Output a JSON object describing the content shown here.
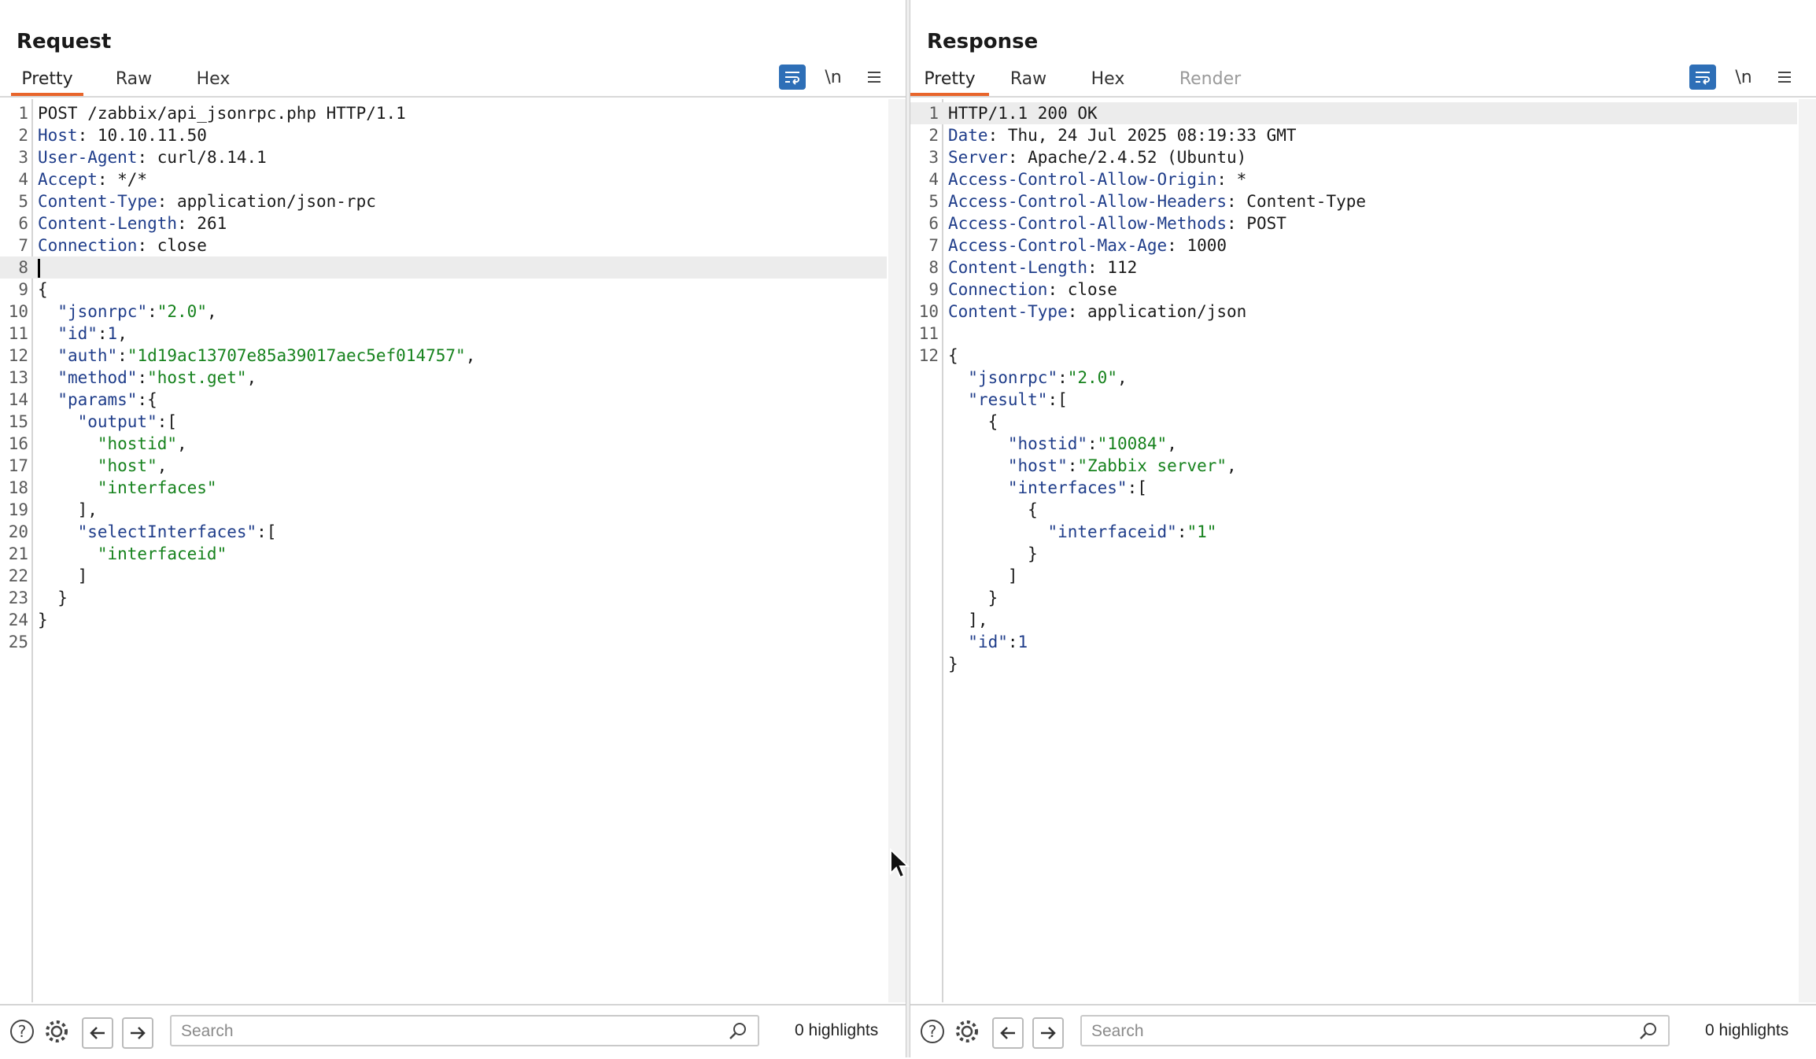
{
  "layout_toggle": {
    "options": [
      "side-by-side",
      "stacked",
      "single"
    ],
    "active": "side-by-side"
  },
  "request": {
    "title": "Request",
    "tabs": [
      {
        "label": "Pretty",
        "active": true
      },
      {
        "label": "Raw"
      },
      {
        "label": "Hex"
      }
    ],
    "toolbar": {
      "wrap_icon": "wrap-icon",
      "newline_label": "\\n",
      "menu_icon": "menu-icon"
    },
    "lines": [
      [
        {
          "t": "POST /zabbix/api_jsonrpc.php HTTP/1.1",
          "c": ""
        }
      ],
      [
        {
          "t": "Host",
          "c": "k"
        },
        {
          "t": ": 10.10.11.50",
          "c": ""
        }
      ],
      [
        {
          "t": "User-Agent",
          "c": "k"
        },
        {
          "t": ": curl/8.14.1",
          "c": ""
        }
      ],
      [
        {
          "t": "Accept",
          "c": "k"
        },
        {
          "t": ": */*",
          "c": ""
        }
      ],
      [
        {
          "t": "Content-Type",
          "c": "k"
        },
        {
          "t": ": application/json-rpc",
          "c": ""
        }
      ],
      [
        {
          "t": "Content-Length",
          "c": "k"
        },
        {
          "t": ": 261",
          "c": ""
        }
      ],
      [
        {
          "t": "Connection",
          "c": "k"
        },
        {
          "t": ": close",
          "c": ""
        }
      ],
      [],
      [
        {
          "t": "{",
          "c": ""
        }
      ],
      [
        {
          "t": "  ",
          "c": ""
        },
        {
          "t": "\"jsonrpc\"",
          "c": "k"
        },
        {
          "t": ":",
          "c": ""
        },
        {
          "t": "\"2.0\"",
          "c": "s"
        },
        {
          "t": ",",
          "c": ""
        }
      ],
      [
        {
          "t": "  ",
          "c": ""
        },
        {
          "t": "\"id\"",
          "c": "k"
        },
        {
          "t": ":",
          "c": ""
        },
        {
          "t": "1",
          "c": "n"
        },
        {
          "t": ",",
          "c": ""
        }
      ],
      [
        {
          "t": "  ",
          "c": ""
        },
        {
          "t": "\"auth\"",
          "c": "k"
        },
        {
          "t": ":",
          "c": ""
        },
        {
          "t": "\"1d19ac13707e85a39017aec5ef014757\"",
          "c": "s"
        },
        {
          "t": ",",
          "c": ""
        }
      ],
      [
        {
          "t": "  ",
          "c": ""
        },
        {
          "t": "\"method\"",
          "c": "k"
        },
        {
          "t": ":",
          "c": ""
        },
        {
          "t": "\"host.get\"",
          "c": "s"
        },
        {
          "t": ",",
          "c": ""
        }
      ],
      [
        {
          "t": "  ",
          "c": ""
        },
        {
          "t": "\"params\"",
          "c": "k"
        },
        {
          "t": ":{",
          "c": ""
        }
      ],
      [
        {
          "t": "    ",
          "c": ""
        },
        {
          "t": "\"output\"",
          "c": "k"
        },
        {
          "t": ":[",
          "c": ""
        }
      ],
      [
        {
          "t": "      ",
          "c": ""
        },
        {
          "t": "\"hostid\"",
          "c": "s"
        },
        {
          "t": ",",
          "c": ""
        }
      ],
      [
        {
          "t": "      ",
          "c": ""
        },
        {
          "t": "\"host\"",
          "c": "s"
        },
        {
          "t": ",",
          "c": ""
        }
      ],
      [
        {
          "t": "      ",
          "c": ""
        },
        {
          "t": "\"interfaces\"",
          "c": "s"
        }
      ],
      [
        {
          "t": "    ],",
          "c": ""
        }
      ],
      [
        {
          "t": "    ",
          "c": ""
        },
        {
          "t": "\"selectInterfaces\"",
          "c": "k"
        },
        {
          "t": ":[",
          "c": ""
        }
      ],
      [
        {
          "t": "      ",
          "c": ""
        },
        {
          "t": "\"interfaceid\"",
          "c": "s"
        }
      ],
      [
        {
          "t": "    ]",
          "c": ""
        }
      ],
      [
        {
          "t": "  }",
          "c": ""
        }
      ],
      [
        {
          "t": "}",
          "c": ""
        }
      ],
      []
    ],
    "highlighted_line": 8,
    "caret_line": 8,
    "search": {
      "placeholder": "Search",
      "value": ""
    },
    "highlights_label": "0 highlights"
  },
  "response": {
    "title": "Response",
    "tabs": [
      {
        "label": "Pretty",
        "active": true
      },
      {
        "label": "Raw"
      },
      {
        "label": "Hex"
      },
      {
        "label": "Render",
        "disabled": true
      }
    ],
    "toolbar": {
      "wrap_icon": "wrap-icon",
      "newline_label": "\\n",
      "menu_icon": "menu-icon"
    },
    "lines": [
      [
        {
          "t": "HTTP/1.1 200 OK",
          "c": ""
        }
      ],
      [
        {
          "t": "Date",
          "c": "k"
        },
        {
          "t": ": Thu, 24 Jul 2025 08:19:33 GMT",
          "c": ""
        }
      ],
      [
        {
          "t": "Server",
          "c": "k"
        },
        {
          "t": ": Apache/2.4.52 (Ubuntu)",
          "c": ""
        }
      ],
      [
        {
          "t": "Access-Control-Allow-Origin",
          "c": "k"
        },
        {
          "t": ": *",
          "c": ""
        }
      ],
      [
        {
          "t": "Access-Control-Allow-Headers",
          "c": "k"
        },
        {
          "t": ": Content-Type",
          "c": ""
        }
      ],
      [
        {
          "t": "Access-Control-Allow-Methods",
          "c": "k"
        },
        {
          "t": ": POST",
          "c": ""
        }
      ],
      [
        {
          "t": "Access-Control-Max-Age",
          "c": "k"
        },
        {
          "t": ": 1000",
          "c": ""
        }
      ],
      [
        {
          "t": "Content-Length",
          "c": "k"
        },
        {
          "t": ": 112",
          "c": ""
        }
      ],
      [
        {
          "t": "Connection",
          "c": "k"
        },
        {
          "t": ": close",
          "c": ""
        }
      ],
      [
        {
          "t": "Content-Type",
          "c": "k"
        },
        {
          "t": ": application/json",
          "c": ""
        }
      ],
      [],
      [
        {
          "t": "{",
          "c": ""
        }
      ],
      [
        {
          "t": "  ",
          "c": ""
        },
        {
          "t": "\"jsonrpc\"",
          "c": "k"
        },
        {
          "t": ":",
          "c": ""
        },
        {
          "t": "\"2.0\"",
          "c": "s"
        },
        {
          "t": ",",
          "c": ""
        }
      ],
      [
        {
          "t": "  ",
          "c": ""
        },
        {
          "t": "\"result\"",
          "c": "k"
        },
        {
          "t": ":[",
          "c": ""
        }
      ],
      [
        {
          "t": "    {",
          "c": ""
        }
      ],
      [
        {
          "t": "      ",
          "c": ""
        },
        {
          "t": "\"hostid\"",
          "c": "k"
        },
        {
          "t": ":",
          "c": ""
        },
        {
          "t": "\"10084\"",
          "c": "s"
        },
        {
          "t": ",",
          "c": ""
        }
      ],
      [
        {
          "t": "      ",
          "c": ""
        },
        {
          "t": "\"host\"",
          "c": "k"
        },
        {
          "t": ":",
          "c": ""
        },
        {
          "t": "\"Zabbix server\"",
          "c": "s"
        },
        {
          "t": ",",
          "c": ""
        }
      ],
      [
        {
          "t": "      ",
          "c": ""
        },
        {
          "t": "\"interfaces\"",
          "c": "k"
        },
        {
          "t": ":[",
          "c": ""
        }
      ],
      [
        {
          "t": "        {",
          "c": ""
        }
      ],
      [
        {
          "t": "          ",
          "c": ""
        },
        {
          "t": "\"interfaceid\"",
          "c": "k"
        },
        {
          "t": ":",
          "c": ""
        },
        {
          "t": "\"1\"",
          "c": "s"
        }
      ],
      [
        {
          "t": "        }",
          "c": ""
        }
      ],
      [
        {
          "t": "      ]",
          "c": ""
        }
      ],
      [
        {
          "t": "    }",
          "c": ""
        }
      ],
      [
        {
          "t": "  ],",
          "c": ""
        }
      ],
      [
        {
          "t": "  ",
          "c": ""
        },
        {
          "t": "\"id\"",
          "c": "k"
        },
        {
          "t": ":",
          "c": ""
        },
        {
          "t": "1",
          "c": "n"
        }
      ],
      [
        {
          "t": "}",
          "c": ""
        }
      ]
    ],
    "numbered_lines": 12,
    "highlighted_line": 1,
    "search": {
      "placeholder": "Search",
      "value": ""
    },
    "highlights_label": "0 highlights"
  },
  "bottom_icons": [
    "help-icon",
    "settings-icon",
    "back-arrow-icon",
    "forward-arrow-icon"
  ],
  "colors": {
    "accent_tab": "#e8652b",
    "button_blue": "#2e6fb7",
    "key": "#1f3d8a",
    "string": "#16821d"
  }
}
